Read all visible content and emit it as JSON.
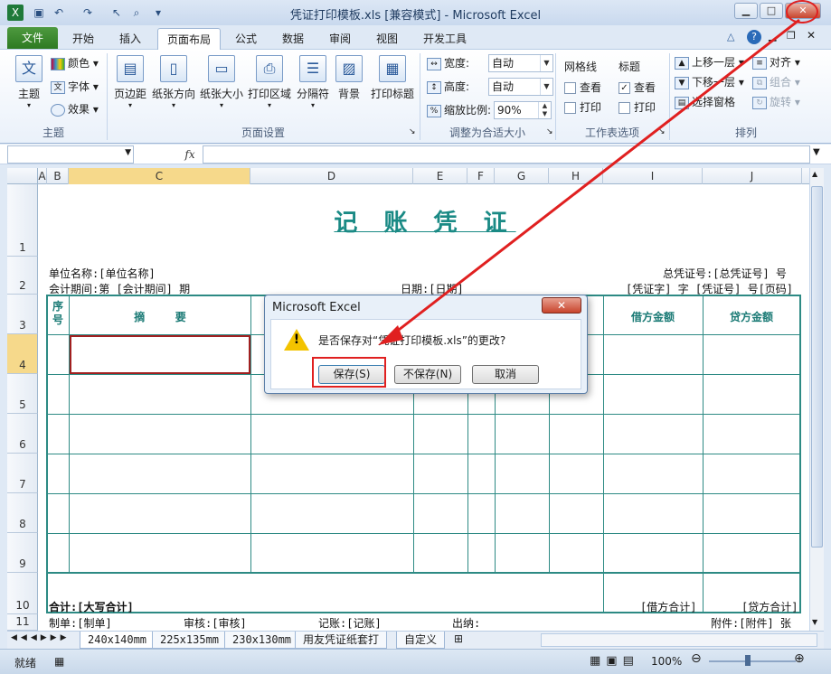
{
  "window": {
    "title": "凭证打印模板.xls  [兼容模式] - Microsoft Excel",
    "qa_icons": [
      "excel-icon",
      "save-icon",
      "undo-icon",
      "redo-icon",
      "cursor-icon",
      "print-preview-icon",
      "customize-icon"
    ]
  },
  "tabs": [
    "文件",
    "开始",
    "插入",
    "页面布局",
    "公式",
    "数据",
    "审阅",
    "视图",
    "开发工具"
  ],
  "active_tab": "页面布局",
  "ribbon": {
    "theme": {
      "big": "主题",
      "small": [
        "颜色",
        "字体",
        "效果"
      ],
      "label": "主题"
    },
    "page_setup": {
      "buttons": [
        "页边距",
        "纸张方向",
        "纸张大小",
        "打印区域",
        "分隔符",
        "背景",
        "打印标题"
      ],
      "label": "页面设置"
    },
    "scale": {
      "width_label": "宽度:",
      "width_value": "自动",
      "height_label": "高度:",
      "height_value": "自动",
      "zoom_label": "缩放比例:",
      "zoom_value": "90%",
      "label": "调整为合适大小"
    },
    "sheet_options": {
      "gridlines": "网格线",
      "headings": "标题",
      "view": "查看",
      "print": "打印",
      "label": "工作表选项",
      "gridlines_view": false,
      "gridlines_print": false,
      "headings_view": true,
      "headings_print": false
    },
    "arrange": {
      "items": [
        "上移一层",
        "下移一层",
        "选择窗格",
        "对齐",
        "组合",
        "旋转"
      ],
      "label": "排列"
    }
  },
  "formula_bar": {
    "fx": "fx"
  },
  "columns": [
    "A",
    "B",
    "C",
    "D",
    "E",
    "F",
    "G",
    "H",
    "I",
    "J"
  ],
  "rows": [
    "1",
    "2",
    "3",
    "4",
    "5",
    "6",
    "7",
    "8",
    "9",
    "10",
    "11"
  ],
  "sheet": {
    "title": "记 账 凭 证",
    "unit": "单位名称:[单位名称]",
    "total_no": "总凭证号:[总凭证号] 号",
    "period": "会计期间:第 [会计期间] 期",
    "date": "日期:[日期]",
    "voucher_no": "[凭证字] 字 [凭证号] 号[页码]",
    "col_seq": "序号",
    "col_summary": "摘        要",
    "col_debit": "借方金额",
    "col_credit": "贷方金额",
    "total_label": "合计:[大写合计]",
    "total_debit": "[借方合计]",
    "total_credit": "[贷方合计]",
    "maker": "制单:[制单]",
    "reviewer": "审核:[审核]",
    "bookkeeper": "记账:[记账]",
    "cashier": "出纳:",
    "attachments": "附件:[附件] 张"
  },
  "sheet_tabs": [
    "240x140mm",
    "225x135mm",
    "230x130mm",
    "用友凭证纸套打",
    "自定义"
  ],
  "active_sheet": "240x140mm",
  "status": {
    "ready": "就绪",
    "zoom": "100%"
  },
  "dialog": {
    "title": "Microsoft Excel",
    "close": "✕",
    "message": "是否保存对“凭证打印模板.xls”的更改?",
    "save": "保存(S)",
    "dont_save": "不保存(N)",
    "cancel": "取消"
  },
  "colors": {
    "accent_green": "#2d7a22",
    "sheet_teal": "#1a8a85",
    "highlight_red": "#e02020"
  }
}
